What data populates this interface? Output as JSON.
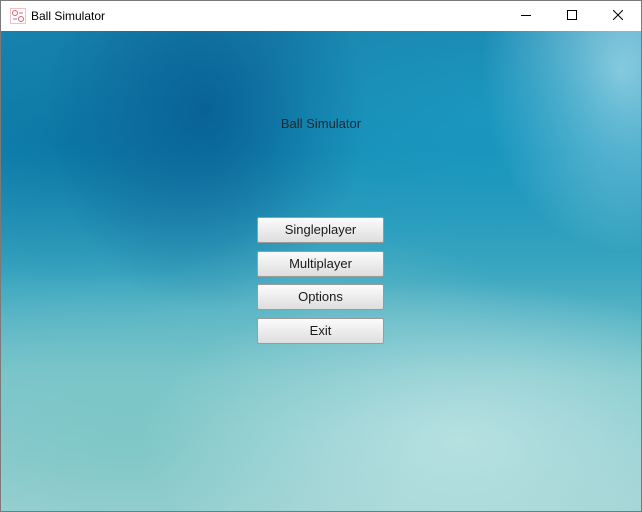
{
  "window": {
    "title": "Ball Simulator",
    "controls": {
      "minimize_icon": "minimize-icon",
      "maximize_icon": "maximize-icon",
      "close_icon": "close-icon"
    }
  },
  "main": {
    "title": "Ball Simulator",
    "buttons": [
      {
        "label": "Singleplayer"
      },
      {
        "label": "Multiplayer"
      },
      {
        "label": "Options"
      },
      {
        "label": "Exit"
      }
    ]
  },
  "colors": {
    "background_primary": "#1790b8",
    "background_light": "#9fd2d2",
    "button_face": "#eeeeee",
    "button_border": "#9a9a9a",
    "text": "#1a1a1a"
  }
}
